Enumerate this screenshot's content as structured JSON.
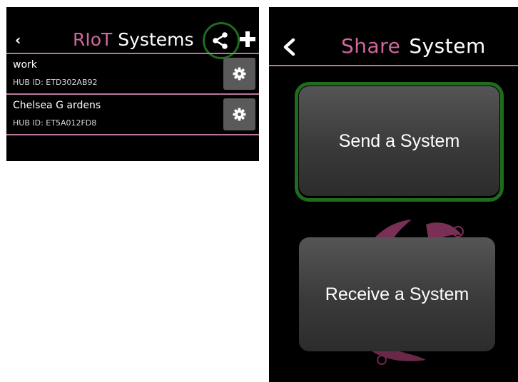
{
  "left_screen": {
    "title_accent": "RIoT",
    "title_rest": "Systems",
    "back_glyph": "‹",
    "icons": [
      "back-chevron-icon",
      "share-icon",
      "plus-icon",
      "gear-icon"
    ],
    "systems": [
      {
        "name": "work",
        "hub_id": "HUB ID: ETD302AB92"
      },
      {
        "name": "Chelsea G ardens",
        "hub_id": "HUB ID: ET5A012FD8"
      }
    ]
  },
  "right_screen": {
    "title_accent": "Share",
    "title_rest": "System",
    "send_label": "Send a System",
    "receive_label": "Receive a System"
  },
  "colors": {
    "accent": "#d0689c",
    "divider": "#b9779d",
    "highlight_ring": "#1f6b1f",
    "background": "#000000",
    "button": "#4a4a4a"
  }
}
